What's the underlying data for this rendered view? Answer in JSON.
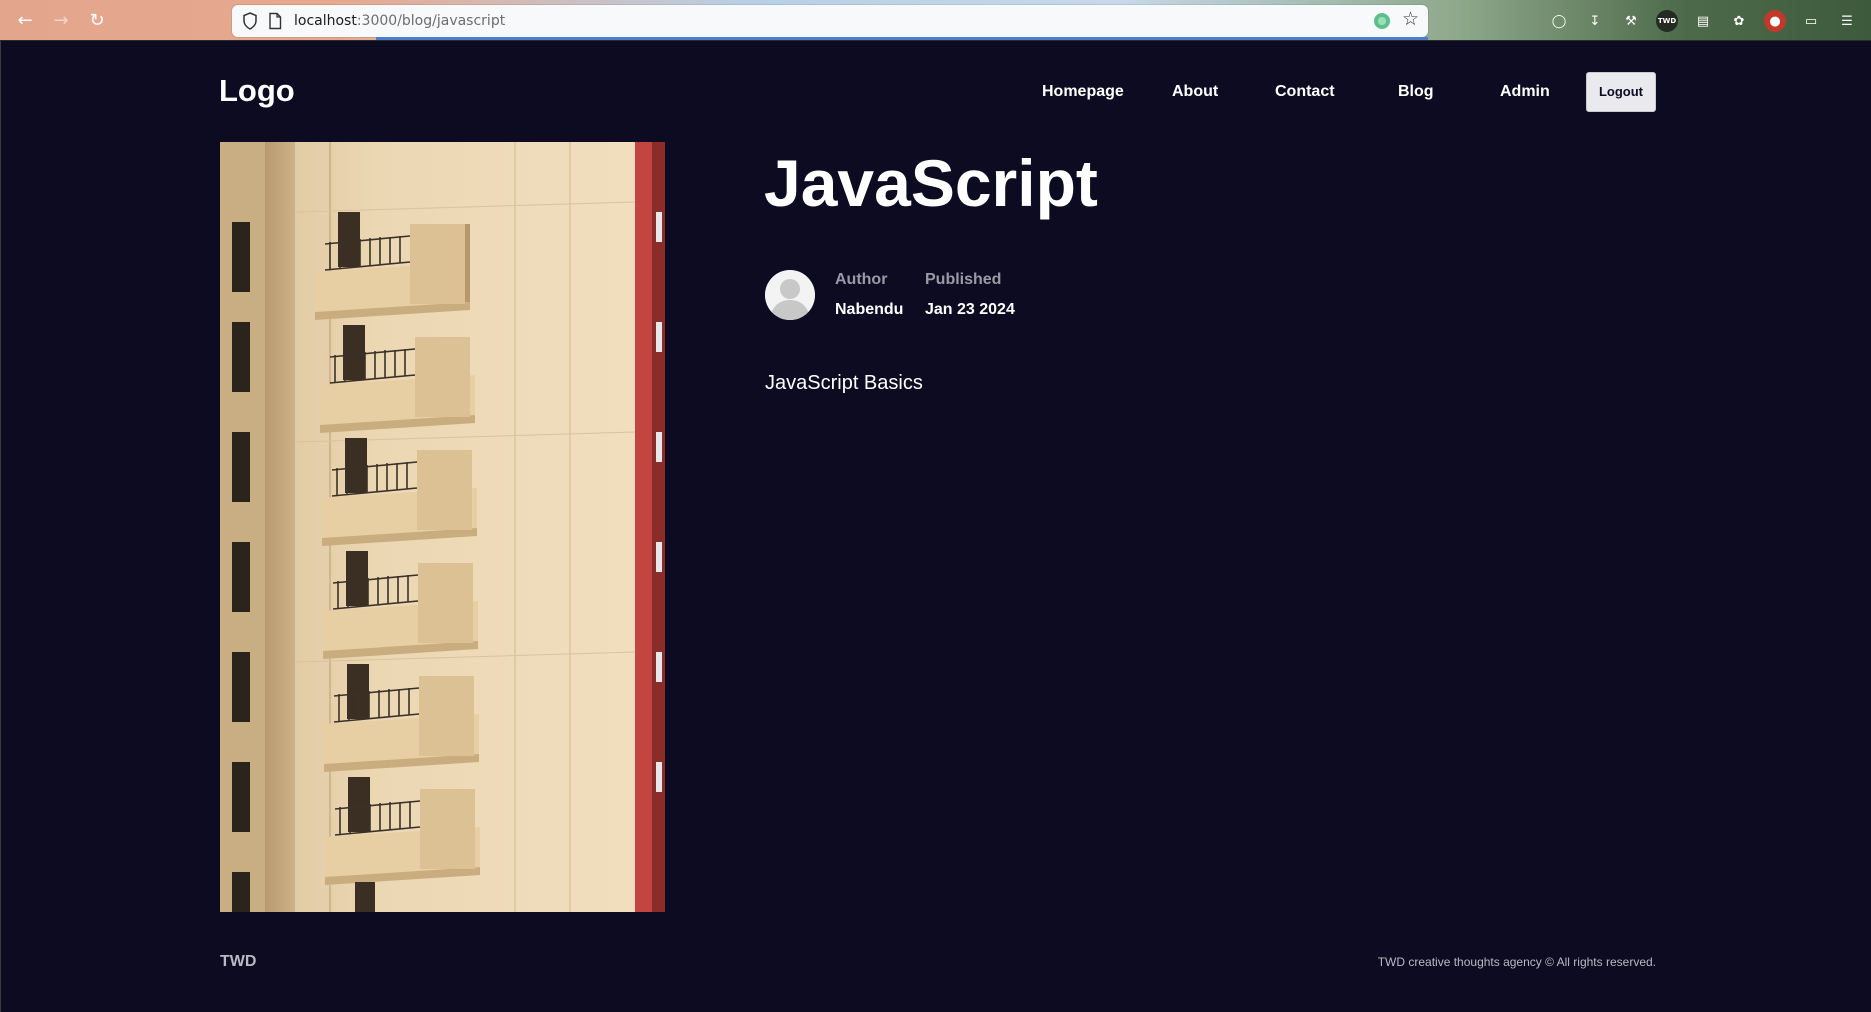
{
  "browser": {
    "url_host": "localhost",
    "url_path": ":3000/blog/javascript",
    "toolbar_icon_labels": [
      "TWD"
    ]
  },
  "header": {
    "logo": "Logo",
    "nav": [
      {
        "label": "Homepage"
      },
      {
        "label": "About"
      },
      {
        "label": "Contact"
      },
      {
        "label": "Blog"
      },
      {
        "label": "Admin"
      }
    ],
    "logout_label": "Logout"
  },
  "post": {
    "title": "JavaScript",
    "author_label": "Author",
    "author_name": "Nabendu",
    "published_label": "Published",
    "published_date": "Jan 23 2024",
    "description": "JavaScript Basics"
  },
  "footer": {
    "brand": "TWD",
    "copyright": "TWD creative thoughts agency © All rights reserved."
  },
  "colors": {
    "page_bg": "#0c0b21",
    "text": "#ffffff",
    "muted": "#9a9aa6",
    "button_bg": "#e9e9ee"
  },
  "icons": {
    "back": "arrow-left-icon",
    "forward": "arrow-right-icon",
    "reload": "reload-icon",
    "shield": "shield-icon",
    "page": "page-icon",
    "bookmark": "star-icon",
    "avatar": "user-avatar-icon"
  }
}
